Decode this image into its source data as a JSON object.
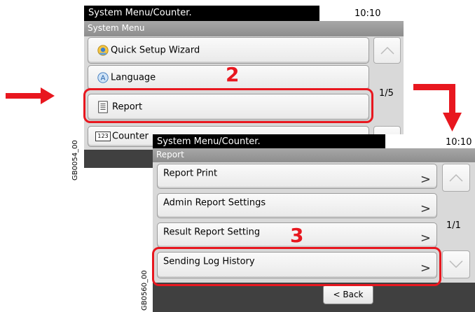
{
  "screen1": {
    "title": "System Menu/Counter.",
    "clock": "10:10",
    "subtitle": "System Menu",
    "items": [
      {
        "label": "Quick Setup Wizard",
        "icon": "wizard-icon"
      },
      {
        "label": "Language",
        "icon": "language-icon"
      },
      {
        "label": "Report",
        "icon": "report-icon"
      },
      {
        "label": "Counter",
        "icon": "counter-icon"
      }
    ],
    "counter_icon_text": "123",
    "page_indicator": "1/5",
    "image_code": "GB0054_00",
    "step_number": "2"
  },
  "screen2": {
    "title": "System Menu/Counter.",
    "clock": "10:10",
    "subtitle": "Report",
    "items": [
      {
        "label": "Report Print"
      },
      {
        "label": "Admin Report Settings"
      },
      {
        "label": "Result Report Setting"
      },
      {
        "label": "Sending Log History"
      }
    ],
    "chevron": ">",
    "page_indicator": "1/1",
    "back_label": "< Back",
    "image_code": "GB0560_00",
    "step_number": "3"
  },
  "colors": {
    "highlight": "#e8171f",
    "arrow": "#e8171f",
    "titlebar": "#000000",
    "footer": "#404040"
  },
  "icons": [
    "right-arrow-icon",
    "down-arrow-icon",
    "scroll-up-icon",
    "scroll-down-icon"
  ]
}
